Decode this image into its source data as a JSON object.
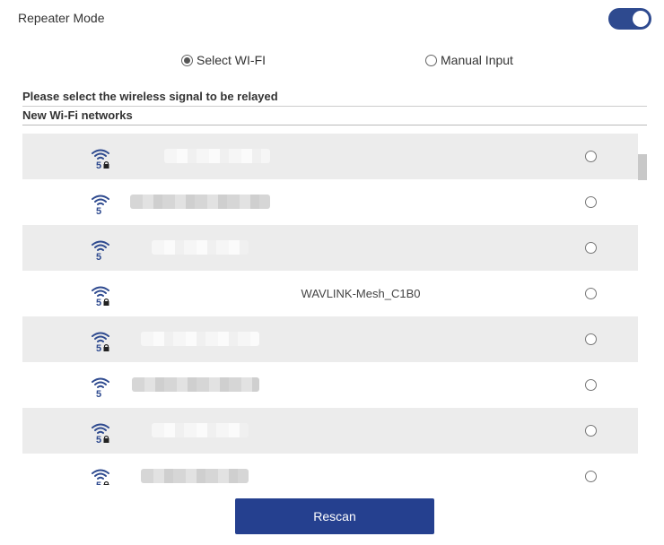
{
  "header": {
    "title": "Repeater Mode",
    "toggle_on": true
  },
  "mode_options": {
    "select_wifi": {
      "label": "Select WI-FI",
      "checked": true
    },
    "manual_input": {
      "label": "Manual Input",
      "checked": false
    }
  },
  "section": {
    "instruction": "Please select the wireless signal to be relayed",
    "list_title": "New Wi-Fi networks"
  },
  "networks": [
    {
      "ssid": "",
      "band": "5",
      "locked": true,
      "hidden": true
    },
    {
      "ssid": "",
      "band": "5",
      "locked": false,
      "hidden": true
    },
    {
      "ssid": "",
      "band": "5",
      "locked": false,
      "hidden": true
    },
    {
      "ssid": "WAVLINK-Mesh_C1B0",
      "band": "5",
      "locked": true,
      "hidden": false
    },
    {
      "ssid": "",
      "band": "5",
      "locked": true,
      "hidden": true
    },
    {
      "ssid": "",
      "band": "5",
      "locked": false,
      "hidden": true
    },
    {
      "ssid": "",
      "band": "5",
      "locked": true,
      "hidden": true
    },
    {
      "ssid": "",
      "band": "5",
      "locked": true,
      "hidden": true
    }
  ],
  "icons": {
    "signal": "wifi-5ghz-icon",
    "lock": "lock-icon"
  },
  "colors": {
    "accent": "#25408f",
    "toggle": "#2e4a8f",
    "row_alt": "#ececec"
  },
  "actions": {
    "rescan_label": "Rescan"
  }
}
